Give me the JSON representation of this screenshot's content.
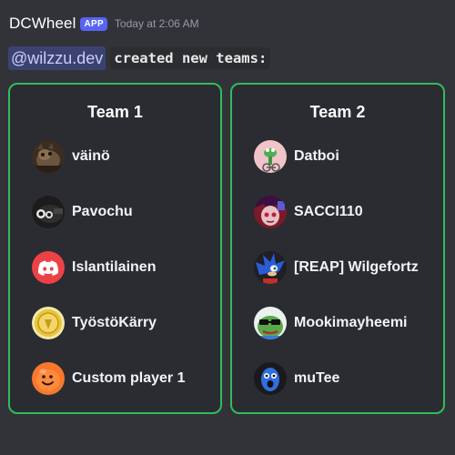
{
  "header": {
    "username": "DCWheel",
    "badge": "APP",
    "timestamp": "Today at 2:06 AM"
  },
  "message": {
    "mention": "@wilzzu.dev",
    "code_text": "created new teams:"
  },
  "teams": [
    {
      "title": "Team 1",
      "players": [
        {
          "name": "väinö",
          "avatar_icon": "cat-avatar-icon"
        },
        {
          "name": "Pavochu",
          "avatar_icon": "animal-avatar-icon"
        },
        {
          "name": "Islantilainen",
          "avatar_icon": "discord-logo-icon"
        },
        {
          "name": "TyöstöKärry",
          "avatar_icon": "coin-avatar-icon"
        },
        {
          "name": "Custom player 1",
          "avatar_icon": "smiley-avatar-icon"
        }
      ]
    },
    {
      "title": "Team 2",
      "players": [
        {
          "name": "Datboi",
          "avatar_icon": "frog-avatar-icon"
        },
        {
          "name": "SACCI110",
          "avatar_icon": "anime-avatar-icon"
        },
        {
          "name": "[REAP] Wilgefortz",
          "avatar_icon": "hedgehog-avatar-icon"
        },
        {
          "name": "Mookimayheemi",
          "avatar_icon": "pepe-avatar-icon"
        },
        {
          "name": "muTee",
          "avatar_icon": "blue-creature-avatar-icon"
        }
      ]
    }
  ],
  "colors": {
    "background": "#323339",
    "card_border": "#2ebd5a",
    "badge": "#5865f2",
    "mention_bg": "#3c4270",
    "discord_red": "#ed4245",
    "smiley_orange": "#f7782d"
  }
}
